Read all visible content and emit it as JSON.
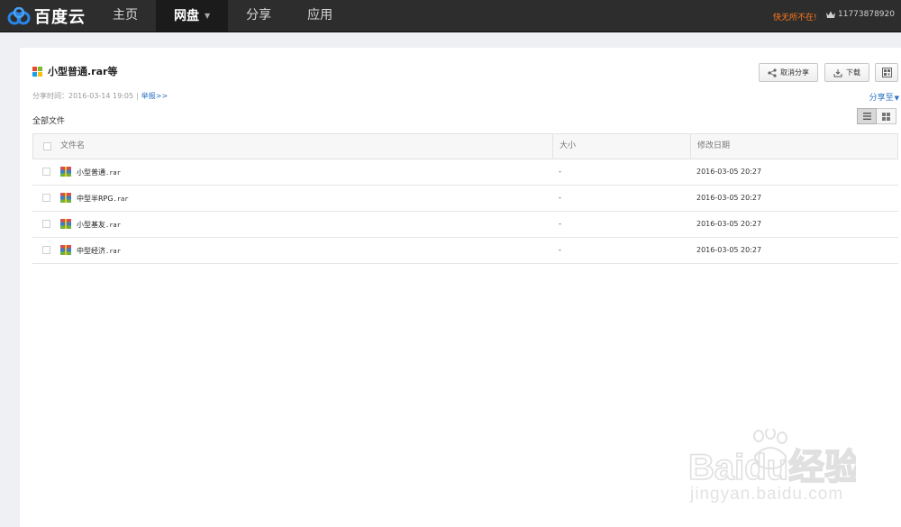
{
  "app": {
    "brand": "百度云"
  },
  "nav": {
    "items": [
      {
        "label": "主页"
      },
      {
        "label": "网盘"
      },
      {
        "label": "分享"
      },
      {
        "label": "应用"
      }
    ],
    "active": "网盘"
  },
  "header": {
    "promo": "快无所不在!",
    "user_id": "11773878920"
  },
  "share": {
    "title": "小型普通.rar等",
    "time_label": "分享时间：2016-03-14 19:05",
    "separator": "|",
    "report_link": "举报>>",
    "cancel_share_label": "取消分享",
    "download_label": "下载",
    "share_to_label": "分享至"
  },
  "files": {
    "section_label": "全部文件",
    "columns": [
      "文件名",
      "大小",
      "修改日期"
    ],
    "rows": [
      {
        "name": "小型普通",
        "ext": ".rar",
        "size": "-",
        "date": "2016-03-05 20:27"
      },
      {
        "name": "中型半RPG",
        "ext": ".rar",
        "size": "-",
        "date": "2016-03-05 20:27"
      },
      {
        "name": "小型基友",
        "ext": ".rar",
        "size": "-",
        "date": "2016-03-05 20:27"
      },
      {
        "name": "中型经济",
        "ext": ".rar",
        "size": "-",
        "date": "2016-03-05 20:27"
      }
    ]
  },
  "watermark": {
    "text": "Baidu经验",
    "url_text": "jingyan.baidu.com"
  },
  "colors": {
    "topbar": "#2d2d2d",
    "promo": "#ff7a1a",
    "link": "#2a6fc4",
    "brand_blue": "#2a86e8"
  },
  "icons": [
    "baidu-cloud-logo-icon",
    "crown-icon",
    "windows-logo-icon",
    "share-icon",
    "download-icon",
    "qrcode-icon",
    "list-view-icon",
    "grid-view-icon",
    "rar-file-icon",
    "chevron-down-icon"
  ]
}
